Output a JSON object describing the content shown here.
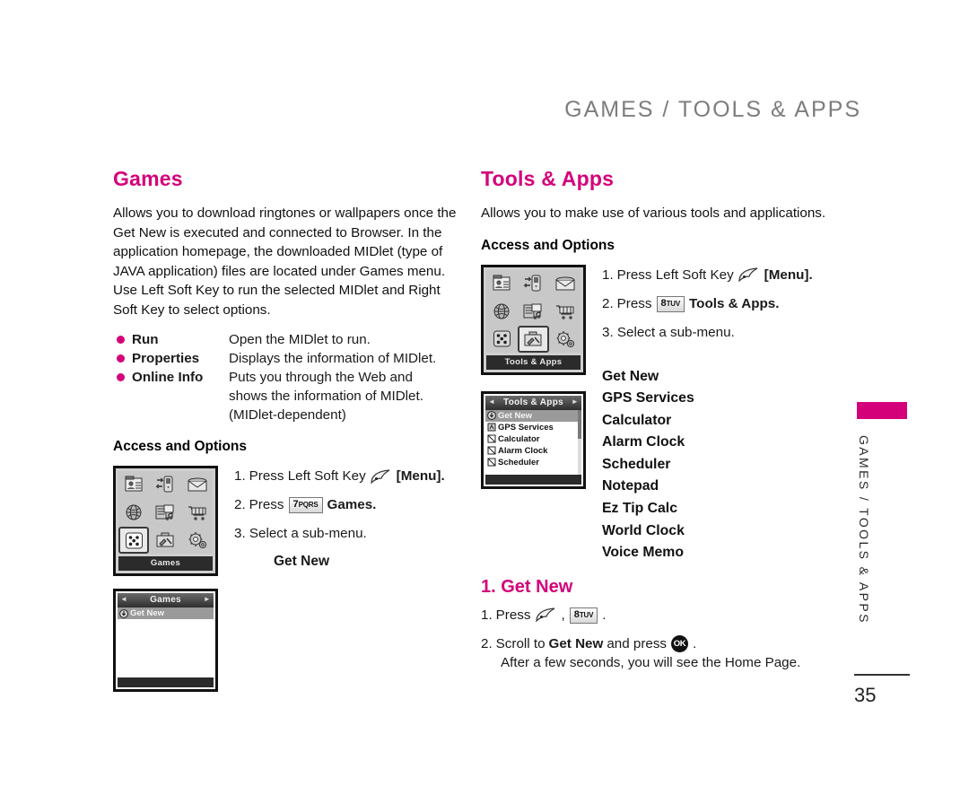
{
  "running_head": "GAMES / TOOLS & APPS",
  "colors": {
    "accent": "#D4007A",
    "head_gray": "#7d7d7d"
  },
  "left": {
    "title": "Games",
    "intro": "Allows you to download ringtones or wallpapers once the Get New is executed and connected to Browser. In the application homepage, the downloaded MIDlet (type of JAVA application) files are located under Games menu. Use Left Soft Key to run the selected MIDlet and Right Soft Key to select options.",
    "options": [
      {
        "term": "Run",
        "def": "Open the MIDlet to run.",
        "cont": []
      },
      {
        "term": "Properties",
        "def": "Displays the information of MIDlet.",
        "cont": []
      },
      {
        "term": "Online Info",
        "def": "Puts you through the Web and",
        "cont": [
          "shows the information of MIDlet.",
          "(MIDlet-dependent)"
        ]
      }
    ],
    "access_heading": "Access and Options",
    "steps": {
      "s1_a": "1.",
      "s1_b": "Press Left Soft Key",
      "s1_c": "[Menu].",
      "s2_a": "2.",
      "s2_b": "Press",
      "s2_key_num": "7",
      "s2_key_letters": "PQRS",
      "s2_c": "Games.",
      "s3": "3. Select a sub-menu."
    },
    "submenu_item": "Get New",
    "grid_caption": "Games",
    "grid_selected_index": 6,
    "list_title": "Games",
    "list_items": [
      "Get New"
    ]
  },
  "right": {
    "title": "Tools & Apps",
    "intro": "Allows you to make use of various tools and applications.",
    "access_heading": "Access and Options",
    "steps": {
      "s1_a": "1.",
      "s1_b": "Press Left Soft Key",
      "s1_c": "[Menu].",
      "s2_a": "2.",
      "s2_b": "Press",
      "s2_key_num": "8",
      "s2_key_letters": "TUV",
      "s2_c": "Tools & Apps.",
      "s3": "3. Select a sub-menu."
    },
    "submenu_items": [
      "Get New",
      "GPS Services",
      "Calculator",
      "Alarm Clock",
      "Scheduler",
      "Notepad",
      "Ez Tip Calc",
      "World Clock",
      "Voice Memo"
    ],
    "grid_caption": "Tools & Apps",
    "grid_selected_index": 7,
    "list_title": "Tools & Apps",
    "list_items": [
      "Get New",
      "GPS Services",
      "Calculator",
      "Alarm Clock",
      "Scheduler"
    ],
    "getnew": {
      "title": "1. Get New",
      "step1_a": "1.",
      "step1_b": "Press",
      "step1_comma": ",",
      "step1_key_num": "8",
      "step1_key_letters": "TUV",
      "step1_period": ".",
      "step2_a": "2.",
      "step2_b": "Scroll to",
      "step2_bold": "Get New",
      "step2_c": "and press",
      "step2_ok": "OK",
      "step2_period": ".",
      "step2_note": "After a few seconds, you will see the Home Page."
    }
  },
  "side_tab": {
    "text": "GAMES / TOOLS & APPS"
  },
  "page_number": "35"
}
